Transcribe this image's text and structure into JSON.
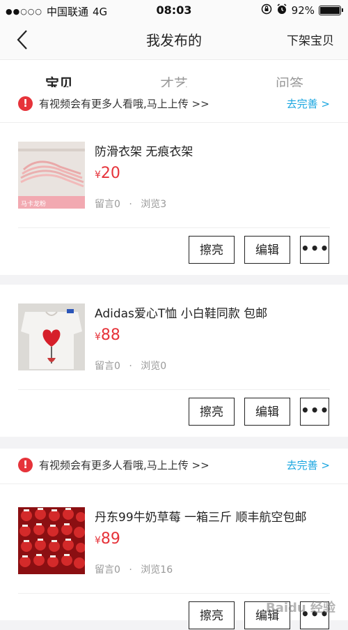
{
  "status_bar": {
    "signal": "●●○○○",
    "carrier": "中国联通",
    "network": "4G",
    "time": "08:03",
    "lock_icon": "rotation-lock-icon",
    "alarm_icon": "alarm-icon",
    "battery_percent": "92%",
    "battery_level": 0.92
  },
  "nav": {
    "back_icon": "chevron-left-icon",
    "title": "我发布的",
    "action": "下架宝贝"
  },
  "tabs": [
    {
      "label": "宝贝",
      "active": true
    },
    {
      "label": "才艺",
      "active": false
    },
    {
      "label": "问答",
      "active": false
    }
  ],
  "top_notice": {
    "text": "有视频会有更多人看哦,马上上传 >>",
    "link": "去完善 >"
  },
  "items": [
    {
      "title": "防滑衣架 无痕衣架",
      "currency": "¥",
      "price": "20",
      "comments": "留言0",
      "views": "浏览3",
      "thumb_label": "马卡龙粉",
      "buttons": {
        "polish": "擦亮",
        "edit": "编辑",
        "more": "•••"
      }
    },
    {
      "title": "Adidas爱心T恤 小白鞋同款 包邮",
      "currency": "¥",
      "price": "88",
      "comments": "留言0",
      "views": "浏览0",
      "buttons": {
        "polish": "擦亮",
        "edit": "编辑",
        "more": "•••"
      }
    },
    {
      "notice": {
        "text": "有视频会有更多人看哦,马上上传 >>",
        "link": "去完善 >"
      },
      "title": "丹东99牛奶草莓 一箱三斤 顺丰航空包邮",
      "currency": "¥",
      "price": "89",
      "comments": "留言0",
      "views": "浏览16",
      "buttons": {
        "polish": "擦亮",
        "edit": "编辑",
        "more": "•••"
      }
    }
  ],
  "separator": "·",
  "watermark": "Baidu 经验",
  "colors": {
    "accent": "#ffd400",
    "price": "#e6333a",
    "link": "#1aa6e0"
  }
}
